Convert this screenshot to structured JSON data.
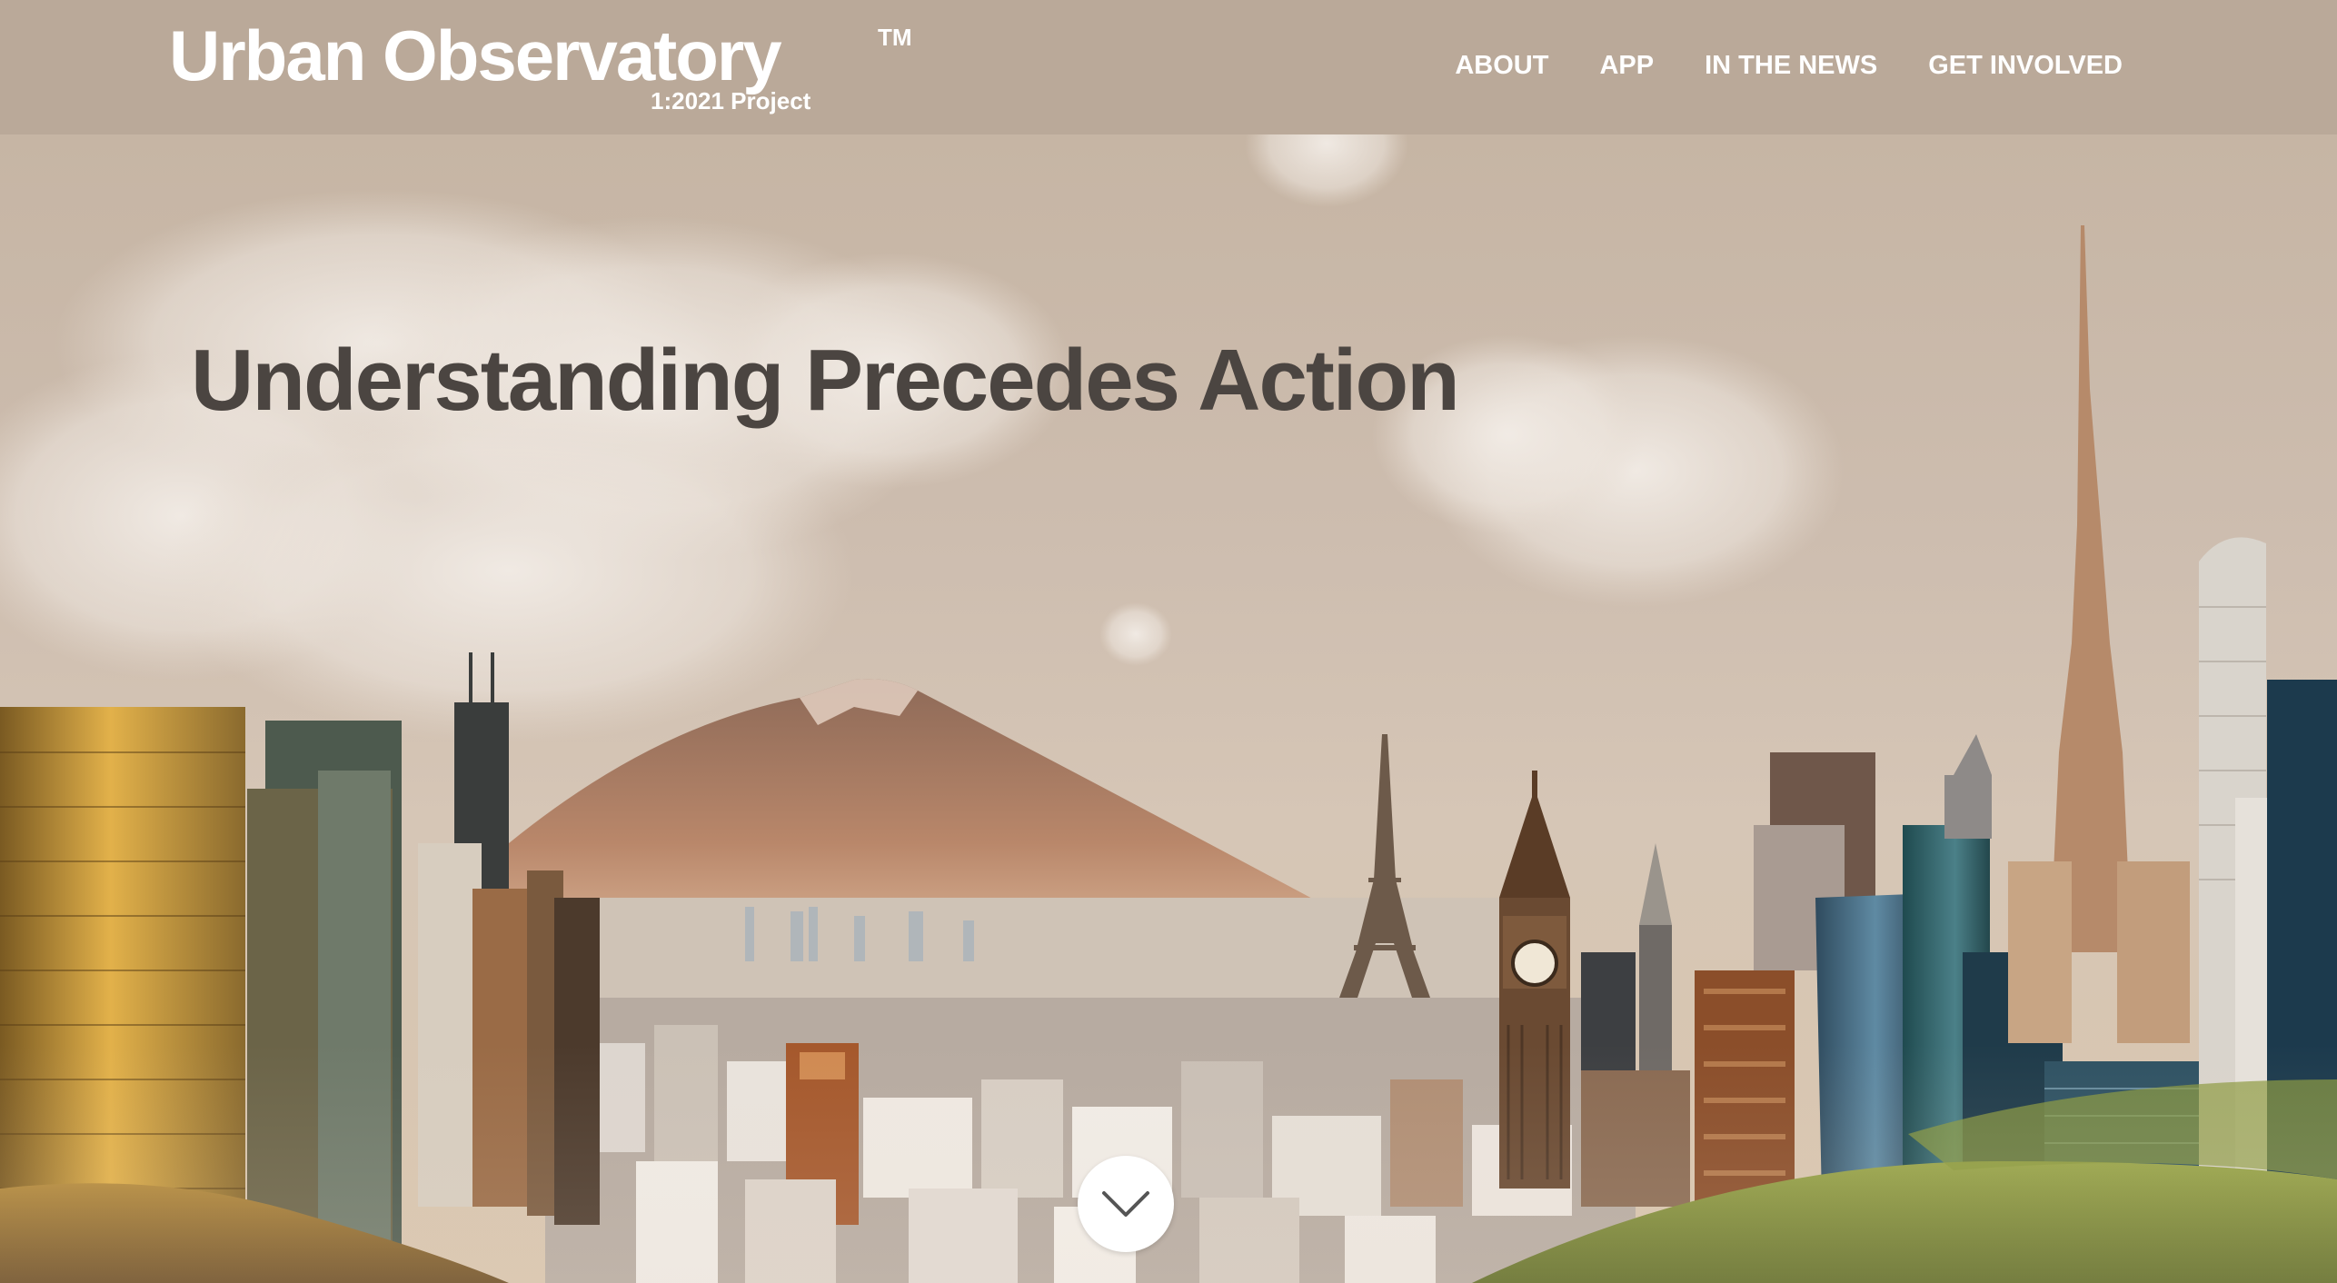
{
  "header": {
    "logo_text": "Urban Observatory",
    "logo_trademark": "TM",
    "logo_subtitle": "1:2021 Project",
    "nav": [
      {
        "label": "ABOUT"
      },
      {
        "label": "APP"
      },
      {
        "label": "IN THE NEWS"
      },
      {
        "label": "GET INVOLVED"
      }
    ]
  },
  "hero": {
    "headline": "Understanding Precedes Action",
    "scroll_icon": "chevron-down-icon"
  },
  "colors": {
    "header_bg": "#baa999",
    "sky": "#cdbdaf",
    "headline": "#4b4541",
    "nav_text": "#ffffff"
  }
}
